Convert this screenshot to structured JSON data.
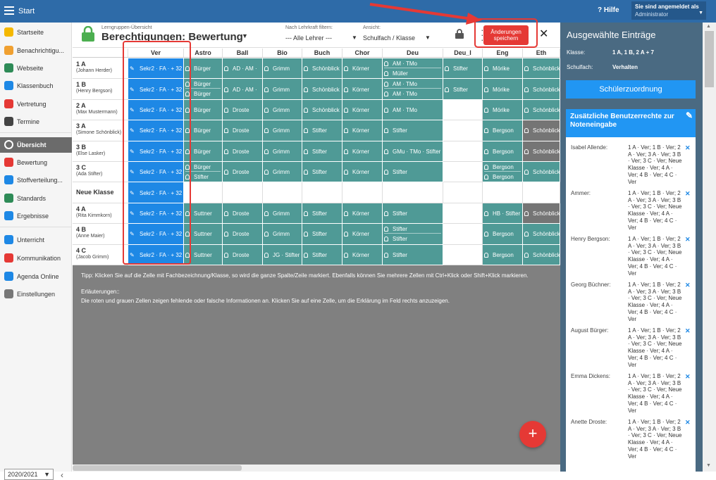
{
  "topbar": {
    "menu_label": "Start",
    "help": "Hilfe",
    "login_line1": "Sie sind angemeldet als",
    "login_line2": "Administrator"
  },
  "sidebar": {
    "items": [
      {
        "label": "Startseite",
        "icon": "star-icon",
        "color": "#f5b800"
      },
      {
        "label": "Benachrichtigu...",
        "icon": "envelope-icon",
        "color": "#f0a030"
      },
      {
        "label": "Webseite",
        "icon": "home-icon",
        "color": "#2e8b57"
      },
      {
        "label": "Klassenbuch",
        "icon": "book-icon",
        "color": "#1e88e5"
      },
      {
        "label": "Vertretung",
        "icon": "user-switch-icon",
        "color": "#e53935"
      },
      {
        "label": "Termine",
        "icon": "calendar-icon",
        "color": "#444444"
      },
      {
        "label": "Übersicht",
        "icon": "check-circle-icon",
        "color": "#ffffff",
        "active": true
      },
      {
        "label": "Bewertung",
        "icon": "grade-icon",
        "color": "#e53935"
      },
      {
        "label": "Stoffverteilung...",
        "icon": "list-icon",
        "color": "#1e88e5"
      },
      {
        "label": "Standards",
        "icon": "shield-check-icon",
        "color": "#2e8b57"
      },
      {
        "label": "Ergebnisse",
        "icon": "chart-icon",
        "color": "#1e88e5"
      },
      {
        "label": "Unterricht",
        "icon": "transfer-icon",
        "color": "#1e88e5"
      },
      {
        "label": "Kommunikation",
        "icon": "chat-icon",
        "color": "#e53935"
      },
      {
        "label": "Agenda Online",
        "icon": "pen-icon",
        "color": "#1e88e5"
      },
      {
        "label": "Einstellungen",
        "icon": "gear-icon",
        "color": "#777777"
      }
    ],
    "year": "2020/2021"
  },
  "header": {
    "supertitle": "Lerngruppen-Übersicht",
    "title": "Berechtigungen: Bewertung",
    "filter_label": "Nach Lehrkraft filtern:",
    "filter_value": "--- Alle Lehrer ---",
    "view_label": "Ansicht:",
    "view_value": "Schulfach / Klasse",
    "save_label_1": "Änderungen",
    "save_label_2": "speichern"
  },
  "table": {
    "columns": [
      "Ver",
      "Astro",
      "Ball",
      "Bio",
      "Buch",
      "Chor",
      "Deu",
      "Deu_I",
      "Eng",
      "Eth"
    ],
    "rows": [
      {
        "name": "1 A",
        "teacher": "(Johann Herder)",
        "cells": [
          {
            "type": "blue",
            "lines": [
              "Sekr2 · FA · + 32"
            ]
          },
          {
            "type": "teal",
            "lines": [
              "Bürger"
            ]
          },
          {
            "type": "teal",
            "lines": [
              "AD · AM ·"
            ]
          },
          {
            "type": "teal",
            "lines": [
              "Grimm"
            ]
          },
          {
            "type": "teal",
            "lines": [
              "Schönblick"
            ]
          },
          {
            "type": "teal",
            "lines": [
              "Körner"
            ]
          },
          {
            "type": "teal",
            "lines": [
              "AM · TMo",
              "Müller"
            ]
          },
          {
            "type": "teal",
            "lines": [
              "Stifter"
            ]
          },
          {
            "type": "teal",
            "lines": [
              "Mörike"
            ]
          },
          {
            "type": "teal",
            "lines": [
              "Schönblick"
            ]
          }
        ]
      },
      {
        "name": "1 B",
        "teacher": "(Henry Bergson)",
        "cells": [
          {
            "type": "blue",
            "lines": [
              "Sekr2 · FA · + 32"
            ]
          },
          {
            "type": "teal",
            "lines": [
              "Bürger",
              "Bürger"
            ]
          },
          {
            "type": "teal",
            "lines": [
              "AD · AM ·"
            ]
          },
          {
            "type": "teal",
            "lines": [
              "Grimm"
            ]
          },
          {
            "type": "teal",
            "lines": [
              "Schönblick"
            ]
          },
          {
            "type": "teal",
            "lines": [
              "Körner"
            ]
          },
          {
            "type": "teal",
            "lines": [
              "AM · TMo",
              "AM · TMo"
            ]
          },
          {
            "type": "teal",
            "lines": [
              "Stifter"
            ]
          },
          {
            "type": "teal",
            "lines": [
              "Mörike"
            ]
          },
          {
            "type": "teal",
            "lines": [
              "Schönblick"
            ]
          }
        ]
      },
      {
        "name": "2 A",
        "teacher": "(Max Mustermann)",
        "cells": [
          {
            "type": "blue",
            "lines": [
              "Sekr2 · FA · + 32"
            ]
          },
          {
            "type": "teal",
            "lines": [
              "Bürger"
            ]
          },
          {
            "type": "teal",
            "lines": [
              "Droste"
            ]
          },
          {
            "type": "teal",
            "lines": [
              "Grimm"
            ]
          },
          {
            "type": "teal",
            "lines": [
              "Schönblick"
            ]
          },
          {
            "type": "teal",
            "lines": [
              "Körner"
            ]
          },
          {
            "type": "teal",
            "lines": [
              "AM · TMo"
            ]
          },
          {
            "type": "white",
            "lines": []
          },
          {
            "type": "teal",
            "lines": [
              "Mörike"
            ]
          },
          {
            "type": "teal",
            "lines": [
              "Schönblick"
            ]
          }
        ]
      },
      {
        "name": "3 A",
        "teacher": "(Simone Schönblick)",
        "cells": [
          {
            "type": "blue",
            "lines": [
              "Sekr2 · FA · + 32"
            ]
          },
          {
            "type": "teal",
            "lines": [
              "Bürger"
            ]
          },
          {
            "type": "teal",
            "lines": [
              "Droste"
            ]
          },
          {
            "type": "teal",
            "lines": [
              "Grimm"
            ]
          },
          {
            "type": "teal",
            "lines": [
              "Stifter"
            ]
          },
          {
            "type": "teal",
            "lines": [
              "Körner"
            ]
          },
          {
            "type": "teal",
            "lines": [
              "Stifter"
            ]
          },
          {
            "type": "white",
            "lines": []
          },
          {
            "type": "teal",
            "lines": [
              "Bergson"
            ]
          },
          {
            "type": "grey",
            "lines": [
              "Schönblick"
            ]
          }
        ]
      },
      {
        "name": "3 B",
        "teacher": "(Else Lasker)",
        "cells": [
          {
            "type": "blue",
            "lines": [
              "Sekr2 · FA · + 32"
            ]
          },
          {
            "type": "teal",
            "lines": [
              "Bürger"
            ]
          },
          {
            "type": "teal",
            "lines": [
              "Droste"
            ]
          },
          {
            "type": "teal",
            "lines": [
              "Grimm"
            ]
          },
          {
            "type": "teal",
            "lines": [
              "Stifter"
            ]
          },
          {
            "type": "teal",
            "lines": [
              "Körner"
            ]
          },
          {
            "type": "teal",
            "lines": [
              "GMu · TMo · Stifter"
            ]
          },
          {
            "type": "white",
            "lines": []
          },
          {
            "type": "teal",
            "lines": [
              "Bergson"
            ]
          },
          {
            "type": "grey",
            "lines": [
              "Schönblick"
            ]
          }
        ]
      },
      {
        "name": "3 C",
        "teacher": "(Ada Stifter)",
        "cells": [
          {
            "type": "blue",
            "lines": [
              "Sekr2 · FA · + 32"
            ]
          },
          {
            "type": "teal",
            "lines": [
              "Bürger",
              "Stifter"
            ]
          },
          {
            "type": "teal",
            "lines": [
              "Droste"
            ]
          },
          {
            "type": "teal",
            "lines": [
              "Grimm"
            ]
          },
          {
            "type": "teal",
            "lines": [
              "Stifter"
            ]
          },
          {
            "type": "teal",
            "lines": [
              "Körner"
            ]
          },
          {
            "type": "teal",
            "lines": [
              "Stifter"
            ]
          },
          {
            "type": "white",
            "lines": []
          },
          {
            "type": "teal",
            "lines": [
              "Bergson",
              "Bergson"
            ]
          },
          {
            "type": "teal",
            "lines": [
              "Schönblick"
            ]
          }
        ]
      },
      {
        "name": "Neue Klasse",
        "teacher": "",
        "cells": [
          {
            "type": "blue",
            "lines": [
              "Sekr2 · FA · + 32"
            ]
          },
          {
            "type": "white",
            "lines": []
          },
          {
            "type": "white",
            "lines": []
          },
          {
            "type": "white",
            "lines": []
          },
          {
            "type": "white",
            "lines": []
          },
          {
            "type": "white",
            "lines": []
          },
          {
            "type": "white",
            "lines": []
          },
          {
            "type": "white",
            "lines": []
          },
          {
            "type": "white",
            "lines": []
          },
          {
            "type": "white",
            "lines": []
          }
        ]
      },
      {
        "name": "4 A",
        "teacher": "(Rita Kimmkorn)",
        "cells": [
          {
            "type": "blue",
            "lines": [
              "Sekr2 · FA · + 32"
            ]
          },
          {
            "type": "teal",
            "lines": [
              "Suttner"
            ]
          },
          {
            "type": "teal",
            "lines": [
              "Droste"
            ]
          },
          {
            "type": "teal",
            "lines": [
              "Grimm"
            ]
          },
          {
            "type": "teal",
            "lines": [
              "Stifter"
            ]
          },
          {
            "type": "teal",
            "lines": [
              "Körner"
            ]
          },
          {
            "type": "teal",
            "lines": [
              "Stifter"
            ]
          },
          {
            "type": "white",
            "lines": []
          },
          {
            "type": "teal",
            "lines": [
              "HB · Stifter"
            ]
          },
          {
            "type": "grey",
            "lines": [
              "Schönblick"
            ]
          }
        ]
      },
      {
        "name": "4 B",
        "teacher": "(Anne Maier)",
        "cells": [
          {
            "type": "blue",
            "lines": [
              "Sekr2 · FA · + 32"
            ]
          },
          {
            "type": "teal",
            "lines": [
              "Suttner"
            ]
          },
          {
            "type": "teal",
            "lines": [
              "Droste"
            ]
          },
          {
            "type": "teal",
            "lines": [
              "Grimm"
            ]
          },
          {
            "type": "teal",
            "lines": [
              "Stifter"
            ]
          },
          {
            "type": "teal",
            "lines": [
              "Körner"
            ]
          },
          {
            "type": "teal",
            "lines": [
              "Stifter",
              "Stifter"
            ]
          },
          {
            "type": "white",
            "lines": []
          },
          {
            "type": "teal",
            "lines": [
              "Bergson"
            ]
          },
          {
            "type": "teal",
            "lines": [
              "Schönblick"
            ]
          }
        ]
      },
      {
        "name": "4 C",
        "teacher": "(Jacob Grimm)",
        "cells": [
          {
            "type": "blue",
            "lines": [
              "Sekr2 · FA · + 32"
            ]
          },
          {
            "type": "teal",
            "lines": [
              "Suttner"
            ]
          },
          {
            "type": "teal",
            "lines": [
              "Droste"
            ]
          },
          {
            "type": "teal",
            "lines": [
              "JG · Stifter"
            ]
          },
          {
            "type": "teal",
            "lines": [
              "Stifter"
            ]
          },
          {
            "type": "teal",
            "lines": [
              "Körner"
            ]
          },
          {
            "type": "teal",
            "lines": [
              "Stifter"
            ]
          },
          {
            "type": "white",
            "lines": []
          },
          {
            "type": "teal",
            "lines": [
              "Bergson"
            ]
          },
          {
            "type": "teal",
            "lines": [
              "Schönblick"
            ]
          }
        ]
      }
    ]
  },
  "info": {
    "tip": "Tipp: Klicken Sie auf die Zelle mit Fachbezeichnung/Klasse, so wird die ganze Spalte/Zeile markiert. Ebenfalls können Sie mehrere Zellen mit Ctrl+Klick oder Shift+Klick markieren.",
    "heading": "Erläuterungen::",
    "explanation": "Die roten und grauen Zellen zeigen fehlende oder falsche Informationen an. Klicken Sie auf eine Zelle, um die Erklärung im Feld rechts anzuzeigen."
  },
  "fab_label": "+",
  "panel": {
    "title": "Ausgewählte Einträge",
    "klasse_label": "Klasse:",
    "klasse_value": "1 A, 1 B, 2 A + 7",
    "fach_label": "Schulfach:",
    "fach_value": "Verhalten",
    "assign_button": "Schülerzuordnung",
    "extra_title": "Zusätzliche Benutzerrechte zur Noteneingabe",
    "users": [
      {
        "name": "Isabel Allende:",
        "rights": "1 A · Ver; 1 B · Ver; 2 A · Ver; 3 A · Ver; 3 B · Ver; 3 C · Ver; Neue Klasse · Ver; 4 A · Ver; 4 B · Ver; 4 C · Ver"
      },
      {
        "name": "Ammer:",
        "rights": "1 A · Ver; 1 B · Ver; 2 A · Ver; 3 A · Ver; 3 B · Ver; 3 C · Ver; Neue Klasse · Ver; 4 A · Ver; 4 B · Ver; 4 C · Ver"
      },
      {
        "name": "Henry Bergson:",
        "rights": "1 A · Ver; 1 B · Ver; 2 A · Ver; 3 A · Ver; 3 B · Ver; 3 C · Ver; Neue Klasse · Ver; 4 A · Ver; 4 B · Ver; 4 C · Ver"
      },
      {
        "name": "Georg Büchner:",
        "rights": "1 A · Ver; 1 B · Ver; 2 A · Ver; 3 A · Ver; 3 B · Ver; 3 C · Ver; Neue Klasse · Ver; 4 A · Ver; 4 B · Ver; 4 C · Ver"
      },
      {
        "name": "August Bürger:",
        "rights": "1 A · Ver; 1 B · Ver; 2 A · Ver; 3 A · Ver; 3 B · Ver; 3 C · Ver; Neue Klasse · Ver; 4 A · Ver; 4 B · Ver; 4 C · Ver"
      },
      {
        "name": "Emma Dickens:",
        "rights": "1 A · Ver; 1 B · Ver; 2 A · Ver; 3 A · Ver; 3 B · Ver; 3 C · Ver; Neue Klasse · Ver; 4 A · Ver; 4 B · Ver; 4 C · Ver"
      },
      {
        "name": "Anette Droste:",
        "rights": "1 A · Ver; 1 B · Ver; 2 A · Ver; 3 A · Ver; 3 B · Ver; 3 C · Ver; Neue Klasse · Ver; 4 A · Ver; 4 B · Ver; 4 C · Ver"
      }
    ]
  },
  "colors": {
    "teal": "#4f9a96",
    "blue": "#1e88e5",
    "grey": "#757575",
    "red": "#e53935",
    "topbar": "#2e6ba8",
    "panel": "#4a6a82"
  }
}
